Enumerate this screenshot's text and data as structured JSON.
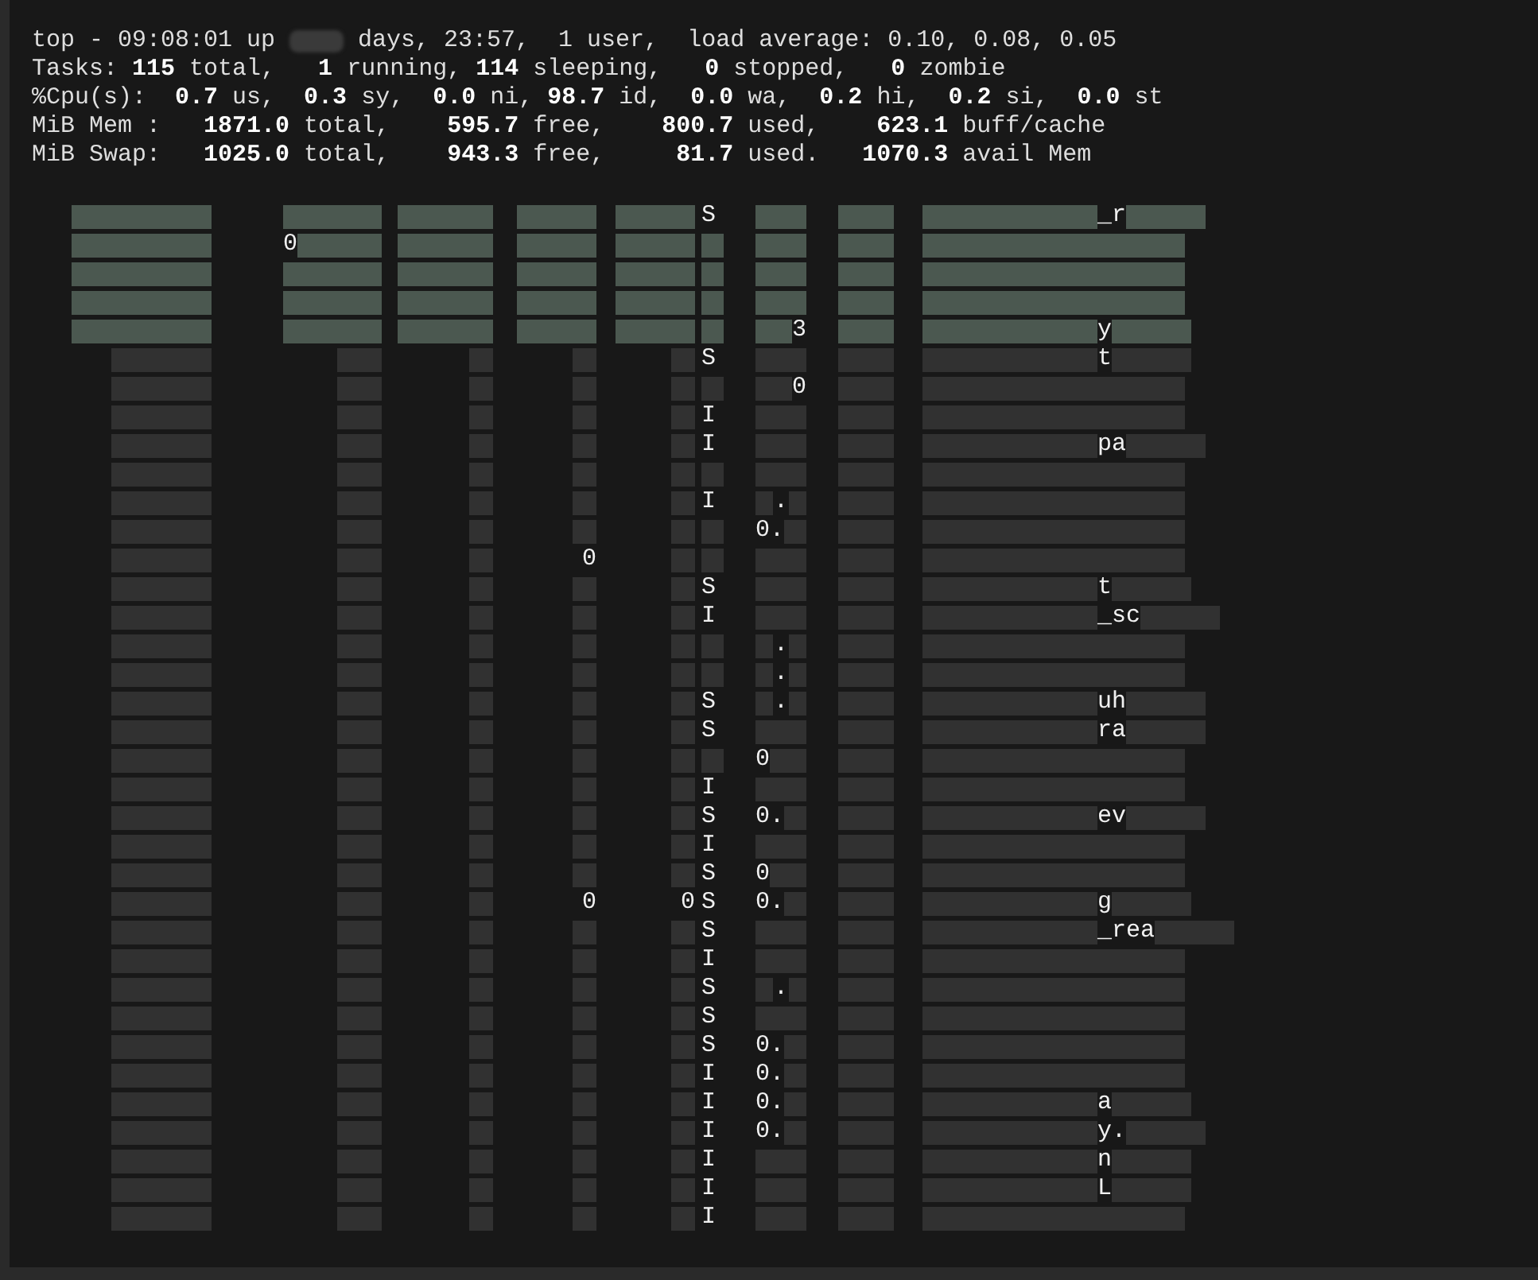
{
  "header": [
    {
      "segments": [
        {
          "text": "top - 09:08:01 up"
        },
        {
          "redacted": true
        },
        {
          "text": "days, 23:57,  1 user,  load average: 0.10, 0.08, 0.05"
        }
      ]
    },
    {
      "segments": [
        {
          "text": "Tasks: **115** total,   **1** running, **114** sleeping,   **0** stopped,   **0** zombie"
        }
      ]
    },
    {
      "segments": [
        {
          "text": "%Cpu(s):  **0.7** us,  **0.3** sy,  **0.0** ni, **98.7** id,  **0.0** wa,  **0.2** hi,  **0.2** si,  **0.0** st"
        }
      ]
    },
    {
      "segments": [
        {
          "text": "MiB Mem :   **1871.0** total,    **595.7** free,    **800.7** used,    **623.1** buff/cache"
        }
      ]
    },
    {
      "segments": [
        {
          "text": "MiB Swap:   **1025.0** total,    **943.3** free,     **81.7** used.   **1070.3** avail Mem"
        }
      ]
    }
  ],
  "rows": [
    {
      "highlighted": true,
      "cells": [
        [
          {
            "redacted": true
          }
        ],
        [
          {
            "redacted": true
          }
        ],
        [
          {
            "redacted": true
          }
        ],
        [
          {
            "redacted": true
          }
        ],
        [
          {
            "redacted": true
          }
        ],
        [
          {
            "text": "S"
          }
        ],
        [
          {
            "redacted": true
          }
        ],
        [
          {
            "redacted": true
          }
        ],
        [
          {
            "redacted": true
          },
          {
            "text": "_r"
          },
          {
            "redacted": true
          }
        ]
      ]
    },
    {
      "highlighted": true,
      "cells": [
        [
          {
            "redacted": true
          }
        ],
        [
          {
            "text": "0"
          },
          {
            "redacted": true
          }
        ],
        [
          {
            "redacted": true
          }
        ],
        [
          {
            "redacted": true
          }
        ],
        [
          {
            "redacted": true
          }
        ],
        [
          {
            "redacted": true
          }
        ],
        [
          {
            "redacted": true
          }
        ],
        [
          {
            "redacted": true
          }
        ],
        [
          {
            "redacted": true
          }
        ]
      ]
    },
    {
      "highlighted": true,
      "cells": [
        [
          {
            "redacted": true
          }
        ],
        [
          {
            "redacted": true
          }
        ],
        [
          {
            "redacted": true
          }
        ],
        [
          {
            "redacted": true
          }
        ],
        [
          {
            "redacted": true
          }
        ],
        [
          {
            "redacted": true
          }
        ],
        [
          {
            "redacted": true
          }
        ],
        [
          {
            "redacted": true
          }
        ],
        [
          {
            "redacted": true
          }
        ]
      ]
    },
    {
      "highlighted": true,
      "cells": [
        [
          {
            "redacted": true
          }
        ],
        [
          {
            "redacted": true
          }
        ],
        [
          {
            "redacted": true
          }
        ],
        [
          {
            "redacted": true
          }
        ],
        [
          {
            "redacted": true
          }
        ],
        [
          {
            "redacted": true
          }
        ],
        [
          {
            "redacted": true
          }
        ],
        [
          {
            "redacted": true
          }
        ],
        [
          {
            "redacted": true
          }
        ]
      ]
    },
    {
      "highlighted": true,
      "cells": [
        [
          {
            "redacted": true
          }
        ],
        [
          {
            "redacted": true
          }
        ],
        [
          {
            "redacted": true
          }
        ],
        [
          {
            "redacted": true
          }
        ],
        [
          {
            "redacted": true
          }
        ],
        [
          {
            "redacted": true
          }
        ],
        [
          {
            "redacted": true
          },
          {
            "text": "3"
          }
        ],
        [
          {
            "redacted": true
          }
        ],
        [
          {
            "redacted": true
          },
          {
            "text": "y"
          },
          {
            "redacted": true
          }
        ]
      ]
    },
    {
      "highlighted": false,
      "cells": [
        [
          {
            "redacted": true
          }
        ],
        [
          {
            "redacted": true
          }
        ],
        [
          {
            "redacted": true
          }
        ],
        [
          {
            "redacted": true
          }
        ],
        [
          {
            "redacted": true
          }
        ],
        [
          {
            "text": "S"
          }
        ],
        [
          {
            "redacted": true
          }
        ],
        [
          {
            "redacted": true
          }
        ],
        [
          {
            "redacted": true
          },
          {
            "text": "t"
          },
          {
            "redacted": true
          }
        ]
      ]
    },
    {
      "highlighted": false,
      "cells": [
        [
          {
            "redacted": true
          }
        ],
        [
          {
            "redacted": true
          }
        ],
        [
          {
            "redacted": true
          }
        ],
        [
          {
            "redacted": true
          }
        ],
        [
          {
            "redacted": true
          }
        ],
        [
          {
            "redacted": true
          }
        ],
        [
          {
            "redacted": true
          },
          {
            "text": "0"
          }
        ],
        [
          {
            "redacted": true
          }
        ],
        [
          {
            "redacted": true
          }
        ]
      ]
    },
    {
      "highlighted": false,
      "cells": [
        [
          {
            "redacted": true
          }
        ],
        [
          {
            "redacted": true
          }
        ],
        [
          {
            "redacted": true
          }
        ],
        [
          {
            "redacted": true
          }
        ],
        [
          {
            "redacted": true
          }
        ],
        [
          {
            "text": "I"
          }
        ],
        [
          {
            "redacted": true
          }
        ],
        [
          {
            "redacted": true
          }
        ],
        [
          {
            "redacted": true
          }
        ]
      ]
    },
    {
      "highlighted": false,
      "cells": [
        [
          {
            "redacted": true
          }
        ],
        [
          {
            "redacted": true
          }
        ],
        [
          {
            "redacted": true
          }
        ],
        [
          {
            "redacted": true
          }
        ],
        [
          {
            "redacted": true
          }
        ],
        [
          {
            "text": "I"
          }
        ],
        [
          {
            "redacted": true
          }
        ],
        [
          {
            "redacted": true
          }
        ],
        [
          {
            "redacted": true
          },
          {
            "text": "pa"
          },
          {
            "redacted": true
          }
        ]
      ]
    },
    {
      "highlighted": false,
      "cells": [
        [
          {
            "redacted": true
          }
        ],
        [
          {
            "redacted": true
          }
        ],
        [
          {
            "redacted": true
          }
        ],
        [
          {
            "redacted": true
          }
        ],
        [
          {
            "redacted": true
          }
        ],
        [
          {
            "redacted": true
          }
        ],
        [
          {
            "redacted": true
          }
        ],
        [
          {
            "redacted": true
          }
        ],
        [
          {
            "redacted": true
          }
        ]
      ]
    },
    {
      "highlighted": false,
      "cells": [
        [
          {
            "redacted": true
          }
        ],
        [
          {
            "redacted": true
          }
        ],
        [
          {
            "redacted": true
          }
        ],
        [
          {
            "redacted": true
          }
        ],
        [
          {
            "redacted": true
          }
        ],
        [
          {
            "text": "I"
          }
        ],
        [
          {
            "redacted": true
          },
          {
            "text": "."
          },
          {
            "redacted": true
          }
        ],
        [
          {
            "redacted": true
          }
        ],
        [
          {
            "redacted": true
          }
        ]
      ]
    },
    {
      "highlighted": false,
      "cells": [
        [
          {
            "redacted": true
          }
        ],
        [
          {
            "redacted": true
          }
        ],
        [
          {
            "redacted": true
          }
        ],
        [
          {
            "redacted": true
          }
        ],
        [
          {
            "redacted": true
          }
        ],
        [
          {
            "redacted": true
          }
        ],
        [
          {
            "text": "0."
          },
          {
            "redacted": true
          }
        ],
        [
          {
            "redacted": true
          }
        ],
        [
          {
            "redacted": true
          }
        ]
      ]
    },
    {
      "highlighted": false,
      "cells": [
        [
          {
            "redacted": true
          }
        ],
        [
          {
            "redacted": true
          }
        ],
        [
          {
            "redacted": true
          }
        ],
        [
          {
            "text": "0"
          }
        ],
        [
          {
            "redacted": true
          }
        ],
        [
          {
            "redacted": true
          }
        ],
        [
          {
            "redacted": true
          }
        ],
        [
          {
            "redacted": true
          }
        ],
        [
          {
            "redacted": true
          }
        ]
      ]
    },
    {
      "highlighted": false,
      "cells": [
        [
          {
            "redacted": true
          }
        ],
        [
          {
            "redacted": true
          }
        ],
        [
          {
            "redacted": true
          }
        ],
        [
          {
            "redacted": true
          }
        ],
        [
          {
            "redacted": true
          }
        ],
        [
          {
            "text": "S"
          }
        ],
        [
          {
            "redacted": true
          }
        ],
        [
          {
            "redacted": true
          }
        ],
        [
          {
            "redacted": true
          },
          {
            "text": "t"
          },
          {
            "redacted": true
          }
        ]
      ]
    },
    {
      "highlighted": false,
      "cells": [
        [
          {
            "redacted": true
          }
        ],
        [
          {
            "redacted": true
          }
        ],
        [
          {
            "redacted": true
          }
        ],
        [
          {
            "redacted": true
          }
        ],
        [
          {
            "redacted": true
          }
        ],
        [
          {
            "text": "I"
          }
        ],
        [
          {
            "redacted": true
          }
        ],
        [
          {
            "redacted": true
          }
        ],
        [
          {
            "redacted": true
          },
          {
            "text": "_sc"
          },
          {
            "redacted": true
          }
        ]
      ]
    },
    {
      "highlighted": false,
      "cells": [
        [
          {
            "redacted": true
          }
        ],
        [
          {
            "redacted": true
          }
        ],
        [
          {
            "redacted": true
          }
        ],
        [
          {
            "redacted": true
          }
        ],
        [
          {
            "redacted": true
          }
        ],
        [
          {
            "redacted": true
          }
        ],
        [
          {
            "redacted": true
          },
          {
            "text": "."
          },
          {
            "redacted": true
          }
        ],
        [
          {
            "redacted": true
          }
        ],
        [
          {
            "redacted": true
          }
        ]
      ]
    },
    {
      "highlighted": false,
      "cells": [
        [
          {
            "redacted": true
          }
        ],
        [
          {
            "redacted": true
          }
        ],
        [
          {
            "redacted": true
          }
        ],
        [
          {
            "redacted": true
          }
        ],
        [
          {
            "redacted": true
          }
        ],
        [
          {
            "redacted": true
          }
        ],
        [
          {
            "redacted": true
          },
          {
            "text": "."
          },
          {
            "redacted": true
          }
        ],
        [
          {
            "redacted": true
          }
        ],
        [
          {
            "redacted": true
          }
        ]
      ]
    },
    {
      "highlighted": false,
      "cells": [
        [
          {
            "redacted": true
          }
        ],
        [
          {
            "redacted": true
          }
        ],
        [
          {
            "redacted": true
          }
        ],
        [
          {
            "redacted": true
          }
        ],
        [
          {
            "redacted": true
          }
        ],
        [
          {
            "text": "S"
          }
        ],
        [
          {
            "redacted": true
          },
          {
            "text": "."
          },
          {
            "redacted": true
          }
        ],
        [
          {
            "redacted": true
          }
        ],
        [
          {
            "redacted": true
          },
          {
            "text": "uh"
          },
          {
            "redacted": true
          }
        ]
      ]
    },
    {
      "highlighted": false,
      "cells": [
        [
          {
            "redacted": true
          }
        ],
        [
          {
            "redacted": true
          }
        ],
        [
          {
            "redacted": true
          }
        ],
        [
          {
            "redacted": true
          }
        ],
        [
          {
            "redacted": true
          }
        ],
        [
          {
            "text": "S"
          }
        ],
        [
          {
            "redacted": true
          }
        ],
        [
          {
            "redacted": true
          }
        ],
        [
          {
            "redacted": true
          },
          {
            "text": "ra"
          },
          {
            "redacted": true
          }
        ]
      ]
    },
    {
      "highlighted": false,
      "cells": [
        [
          {
            "redacted": true
          }
        ],
        [
          {
            "redacted": true
          }
        ],
        [
          {
            "redacted": true
          }
        ],
        [
          {
            "redacted": true
          }
        ],
        [
          {
            "redacted": true
          }
        ],
        [
          {
            "redacted": true
          }
        ],
        [
          {
            "text": "0"
          },
          {
            "redacted": true
          }
        ],
        [
          {
            "redacted": true
          }
        ],
        [
          {
            "redacted": true
          }
        ]
      ]
    },
    {
      "highlighted": false,
      "cells": [
        [
          {
            "redacted": true
          }
        ],
        [
          {
            "redacted": true
          }
        ],
        [
          {
            "redacted": true
          }
        ],
        [
          {
            "redacted": true
          }
        ],
        [
          {
            "redacted": true
          }
        ],
        [
          {
            "text": "I"
          }
        ],
        [
          {
            "redacted": true
          }
        ],
        [
          {
            "redacted": true
          }
        ],
        [
          {
            "redacted": true
          }
        ]
      ]
    },
    {
      "highlighted": false,
      "cells": [
        [
          {
            "redacted": true
          }
        ],
        [
          {
            "redacted": true
          }
        ],
        [
          {
            "redacted": true
          }
        ],
        [
          {
            "redacted": true
          }
        ],
        [
          {
            "redacted": true
          }
        ],
        [
          {
            "text": "S"
          }
        ],
        [
          {
            "text": "0."
          },
          {
            "redacted": true
          }
        ],
        [
          {
            "redacted": true
          }
        ],
        [
          {
            "redacted": true
          },
          {
            "text": "ev"
          },
          {
            "redacted": true
          }
        ]
      ]
    },
    {
      "highlighted": false,
      "cells": [
        [
          {
            "redacted": true
          }
        ],
        [
          {
            "redacted": true
          }
        ],
        [
          {
            "redacted": true
          }
        ],
        [
          {
            "redacted": true
          }
        ],
        [
          {
            "redacted": true
          }
        ],
        [
          {
            "text": "I"
          }
        ],
        [
          {
            "redacted": true
          }
        ],
        [
          {
            "redacted": true
          }
        ],
        [
          {
            "redacted": true
          }
        ]
      ]
    },
    {
      "highlighted": false,
      "cells": [
        [
          {
            "redacted": true
          }
        ],
        [
          {
            "redacted": true
          }
        ],
        [
          {
            "redacted": true
          }
        ],
        [
          {
            "redacted": true
          }
        ],
        [
          {
            "redacted": true
          }
        ],
        [
          {
            "text": "S"
          }
        ],
        [
          {
            "text": "0"
          },
          {
            "redacted": true
          }
        ],
        [
          {
            "redacted": true
          }
        ],
        [
          {
            "redacted": true
          }
        ]
      ]
    },
    {
      "highlighted": false,
      "cells": [
        [
          {
            "redacted": true
          }
        ],
        [
          {
            "redacted": true
          }
        ],
        [
          {
            "redacted": true
          }
        ],
        [
          {
            "text": "0"
          }
        ],
        [
          {
            "text": "0"
          }
        ],
        [
          {
            "text": "S"
          }
        ],
        [
          {
            "text": "0."
          },
          {
            "redacted": true
          }
        ],
        [
          {
            "redacted": true
          }
        ],
        [
          {
            "redacted": true
          },
          {
            "text": "g"
          },
          {
            "redacted": true
          }
        ]
      ]
    },
    {
      "highlighted": false,
      "cells": [
        [
          {
            "redacted": true
          }
        ],
        [
          {
            "redacted": true
          }
        ],
        [
          {
            "redacted": true
          }
        ],
        [
          {
            "redacted": true
          }
        ],
        [
          {
            "redacted": true
          }
        ],
        [
          {
            "text": "S"
          }
        ],
        [
          {
            "redacted": true
          }
        ],
        [
          {
            "redacted": true
          }
        ],
        [
          {
            "redacted": true
          },
          {
            "text": "_rea"
          },
          {
            "redacted": true
          }
        ]
      ]
    },
    {
      "highlighted": false,
      "cells": [
        [
          {
            "redacted": true
          }
        ],
        [
          {
            "redacted": true
          }
        ],
        [
          {
            "redacted": true
          }
        ],
        [
          {
            "redacted": true
          }
        ],
        [
          {
            "redacted": true
          }
        ],
        [
          {
            "text": "I"
          }
        ],
        [
          {
            "redacted": true
          }
        ],
        [
          {
            "redacted": true
          }
        ],
        [
          {
            "redacted": true
          }
        ]
      ]
    },
    {
      "highlighted": false,
      "cells": [
        [
          {
            "redacted": true
          }
        ],
        [
          {
            "redacted": true
          }
        ],
        [
          {
            "redacted": true
          }
        ],
        [
          {
            "redacted": true
          }
        ],
        [
          {
            "redacted": true
          }
        ],
        [
          {
            "text": "S"
          }
        ],
        [
          {
            "redacted": true
          },
          {
            "text": "."
          },
          {
            "redacted": true
          }
        ],
        [
          {
            "redacted": true
          }
        ],
        [
          {
            "redacted": true
          }
        ]
      ]
    },
    {
      "highlighted": false,
      "cells": [
        [
          {
            "redacted": true
          }
        ],
        [
          {
            "redacted": true
          }
        ],
        [
          {
            "redacted": true
          }
        ],
        [
          {
            "redacted": true
          }
        ],
        [
          {
            "redacted": true
          }
        ],
        [
          {
            "text": "S"
          }
        ],
        [
          {
            "redacted": true
          }
        ],
        [
          {
            "redacted": true
          }
        ],
        [
          {
            "redacted": true
          }
        ]
      ]
    },
    {
      "highlighted": false,
      "cells": [
        [
          {
            "redacted": true
          }
        ],
        [
          {
            "redacted": true
          }
        ],
        [
          {
            "redacted": true
          }
        ],
        [
          {
            "redacted": true
          }
        ],
        [
          {
            "redacted": true
          }
        ],
        [
          {
            "text": "S"
          }
        ],
        [
          {
            "text": "0."
          },
          {
            "redacted": true
          }
        ],
        [
          {
            "redacted": true
          }
        ],
        [
          {
            "redacted": true
          }
        ]
      ]
    },
    {
      "highlighted": false,
      "cells": [
        [
          {
            "redacted": true
          }
        ],
        [
          {
            "redacted": true
          }
        ],
        [
          {
            "redacted": true
          }
        ],
        [
          {
            "redacted": true
          }
        ],
        [
          {
            "redacted": true
          }
        ],
        [
          {
            "text": "I"
          }
        ],
        [
          {
            "text": "0."
          },
          {
            "redacted": true
          }
        ],
        [
          {
            "redacted": true
          }
        ],
        [
          {
            "redacted": true
          }
        ]
      ]
    },
    {
      "highlighted": false,
      "cells": [
        [
          {
            "redacted": true
          }
        ],
        [
          {
            "redacted": true
          }
        ],
        [
          {
            "redacted": true
          }
        ],
        [
          {
            "redacted": true
          }
        ],
        [
          {
            "redacted": true
          }
        ],
        [
          {
            "text": "I"
          }
        ],
        [
          {
            "text": "0."
          },
          {
            "redacted": true
          }
        ],
        [
          {
            "redacted": true
          }
        ],
        [
          {
            "redacted": true
          },
          {
            "text": "a"
          },
          {
            "redacted": true
          }
        ]
      ]
    },
    {
      "highlighted": false,
      "cells": [
        [
          {
            "redacted": true
          }
        ],
        [
          {
            "redacted": true
          }
        ],
        [
          {
            "redacted": true
          }
        ],
        [
          {
            "redacted": true
          }
        ],
        [
          {
            "redacted": true
          }
        ],
        [
          {
            "text": "I"
          }
        ],
        [
          {
            "text": "0."
          },
          {
            "redacted": true
          }
        ],
        [
          {
            "redacted": true
          }
        ],
        [
          {
            "redacted": true
          },
          {
            "text": "y."
          },
          {
            "redacted": true
          }
        ]
      ]
    },
    {
      "highlighted": false,
      "cells": [
        [
          {
            "redacted": true
          }
        ],
        [
          {
            "redacted": true
          }
        ],
        [
          {
            "redacted": true
          }
        ],
        [
          {
            "redacted": true
          }
        ],
        [
          {
            "redacted": true
          }
        ],
        [
          {
            "text": "I"
          }
        ],
        [
          {
            "redacted": true
          }
        ],
        [
          {
            "redacted": true
          }
        ],
        [
          {
            "redacted": true
          },
          {
            "text": "n"
          },
          {
            "redacted": true
          }
        ]
      ]
    },
    {
      "highlighted": false,
      "cells": [
        [
          {
            "redacted": true
          }
        ],
        [
          {
            "redacted": true
          }
        ],
        [
          {
            "redacted": true
          }
        ],
        [
          {
            "redacted": true
          }
        ],
        [
          {
            "redacted": true
          }
        ],
        [
          {
            "text": "I"
          }
        ],
        [
          {
            "redacted": true
          }
        ],
        [
          {
            "redacted": true
          }
        ],
        [
          {
            "redacted": true
          },
          {
            "text": "L"
          },
          {
            "redacted": true
          }
        ]
      ]
    },
    {
      "highlighted": false,
      "cells": [
        [
          {
            "redacted": true
          }
        ],
        [
          {
            "redacted": true
          }
        ],
        [
          {
            "redacted": true
          }
        ],
        [
          {
            "redacted": true
          }
        ],
        [
          {
            "redacted": true
          }
        ],
        [
          {
            "text": "I"
          }
        ],
        [
          {
            "redacted": true
          }
        ],
        [
          {
            "redacted": true
          }
        ],
        [
          {
            "redacted": true
          }
        ]
      ]
    }
  ]
}
